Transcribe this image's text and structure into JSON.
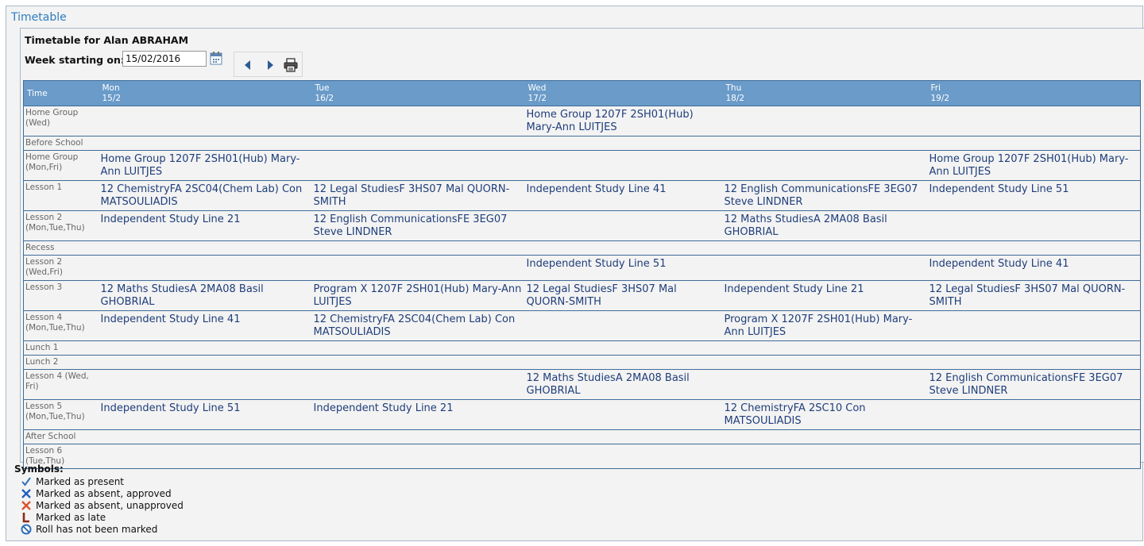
{
  "page": {
    "title": "Timetable",
    "heading": "Timetable for Alan ABRAHAM",
    "week_label": "Week starting on:",
    "week_value": "15/02/2016"
  },
  "timetable": {
    "time_header": "Time",
    "days": [
      {
        "name": "Mon",
        "date": "15/2"
      },
      {
        "name": "Tue",
        "date": "16/2"
      },
      {
        "name": "Wed",
        "date": "17/2"
      },
      {
        "name": "Thu",
        "date": "18/2"
      },
      {
        "name": "Fri",
        "date": "19/2"
      }
    ],
    "rows": [
      {
        "period": "Home Group (Wed)",
        "cells": [
          "",
          "",
          "Home Group 1207F 2SH01(Hub) Mary-Ann LUITJES",
          "",
          ""
        ]
      },
      {
        "period": "Before School",
        "cells": [
          "",
          "",
          "",
          "",
          ""
        ]
      },
      {
        "period": "Home Group (Mon,Fri)",
        "cells": [
          "Home Group 1207F 2SH01(Hub) Mary-Ann LUITJES",
          "",
          "",
          "",
          "Home Group 1207F 2SH01(Hub) Mary-Ann LUITJES"
        ]
      },
      {
        "period": "Lesson 1",
        "cells": [
          "12 ChemistryFA 2SC04(Chem Lab) Con MATSOULIADIS",
          "12 Legal StudiesF 3HS07 Mal QUORN-SMITH",
          "Independent Study Line 41",
          "12 English CommunicationsFE 3EG07 Steve LINDNER",
          "Independent Study Line 51"
        ]
      },
      {
        "period": "Lesson 2 (Mon,Tue,Thu)",
        "cells": [
          "Independent Study Line 21",
          "12 English CommunicationsFE 3EG07 Steve LINDNER",
          "",
          "12 Maths StudiesA 2MA08 Basil GHOBRIAL",
          ""
        ]
      },
      {
        "period": "Recess",
        "cells": [
          "",
          "",
          "",
          "",
          ""
        ]
      },
      {
        "period": "Lesson 2 (Wed,Fri)",
        "cells": [
          "",
          "",
          "Independent Study Line 51",
          "",
          "Independent Study Line 41"
        ]
      },
      {
        "period": "Lesson 3",
        "cells": [
          "12 Maths StudiesA 2MA08 Basil GHOBRIAL",
          "Program X 1207F 2SH01(Hub) Mary-Ann LUITJES",
          "12 Legal StudiesF 3HS07 Mal QUORN-SMITH",
          "Independent Study Line 21",
          "12 Legal StudiesF 3HS07 Mal QUORN-SMITH"
        ]
      },
      {
        "period": "Lesson 4 (Mon,Tue,Thu)",
        "cells": [
          "Independent Study Line 41",
          "12 ChemistryFA 2SC04(Chem Lab) Con MATSOULIADIS",
          "",
          "Program X 1207F 2SH01(Hub) Mary-Ann LUITJES",
          ""
        ]
      },
      {
        "period": "Lunch 1",
        "cells": [
          "",
          "",
          "",
          "",
          ""
        ]
      },
      {
        "period": "Lunch 2",
        "cells": [
          "",
          "",
          "",
          "",
          ""
        ]
      },
      {
        "period": "Lesson 4 (Wed, Fri)",
        "cells": [
          "",
          "",
          "12 Maths StudiesA 2MA08 Basil GHOBRIAL",
          "",
          "12 English CommunicationsFE 3EG07 Steve LINDNER"
        ]
      },
      {
        "period": "Lesson 5 (Mon,Tue,Thu)",
        "cells": [
          "Independent Study Line 51",
          "Independent Study Line 21",
          "",
          "12 ChemistryFA 2SC10 Con MATSOULIADIS",
          ""
        ]
      },
      {
        "period": "After School",
        "cells": [
          "",
          "",
          "",
          "",
          ""
        ]
      },
      {
        "period": "Lesson 6 (Tue,Thu)",
        "cells": [
          "",
          "",
          "",
          "",
          ""
        ]
      }
    ]
  },
  "symbols": {
    "title": "Symbols:",
    "items": [
      {
        "icon": "check-icon",
        "label": "Marked as present",
        "color": "#2f6fb6"
      },
      {
        "icon": "cross-approved-icon",
        "label": "Marked as absent, approved",
        "color": "#1f5fc0"
      },
      {
        "icon": "cross-unapproved-icon",
        "label": "Marked as absent, unapproved",
        "color": "#d9542b"
      },
      {
        "icon": "late-icon",
        "label": "Marked as late",
        "color": "#8b2b1a"
      },
      {
        "icon": "not-marked-icon",
        "label": "Roll has not been marked",
        "color": "#2f6fb6"
      }
    ]
  },
  "colors": {
    "header_bg": "#6a9bc9",
    "link_text": "#1f3e7a",
    "title_blue": "#2e7cc1"
  }
}
